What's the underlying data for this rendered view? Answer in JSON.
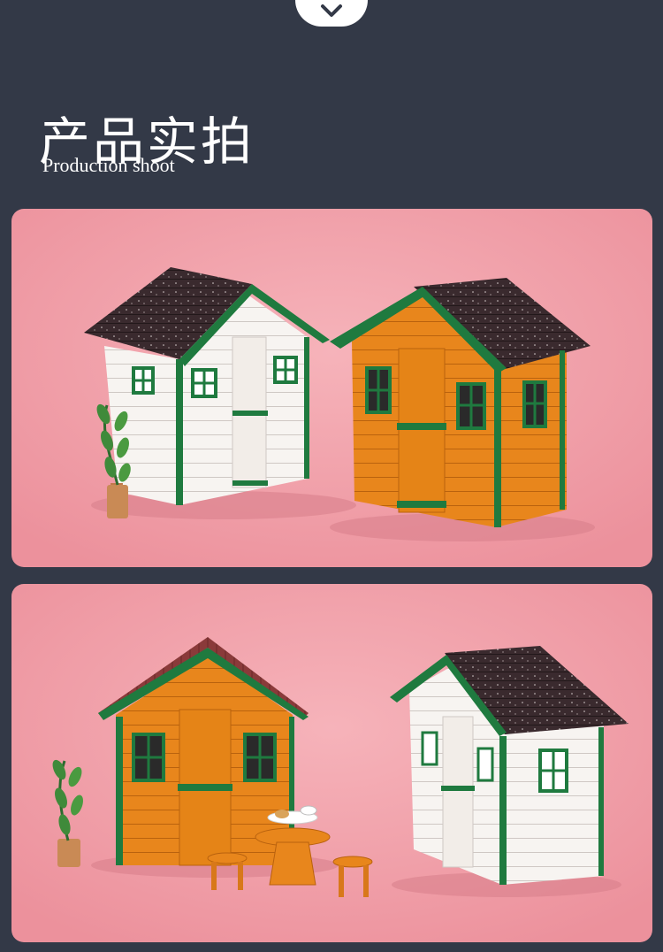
{
  "header": {
    "scroll_icon": "chevron-down-icon",
    "title": "产品实拍",
    "subtitle": "Production shoot"
  },
  "photos": [
    {
      "subject": "white-and-orange-miniature-sheds",
      "background": "#f2a2ab"
    },
    {
      "subject": "orange-shed-with-table-and-white-shed",
      "background": "#f2a2ab"
    }
  ],
  "colors": {
    "page_background": "#333947",
    "trim_green": "#1f7a3f",
    "orange_wood": "#e8861c",
    "roof": "#3a2a2e"
  }
}
